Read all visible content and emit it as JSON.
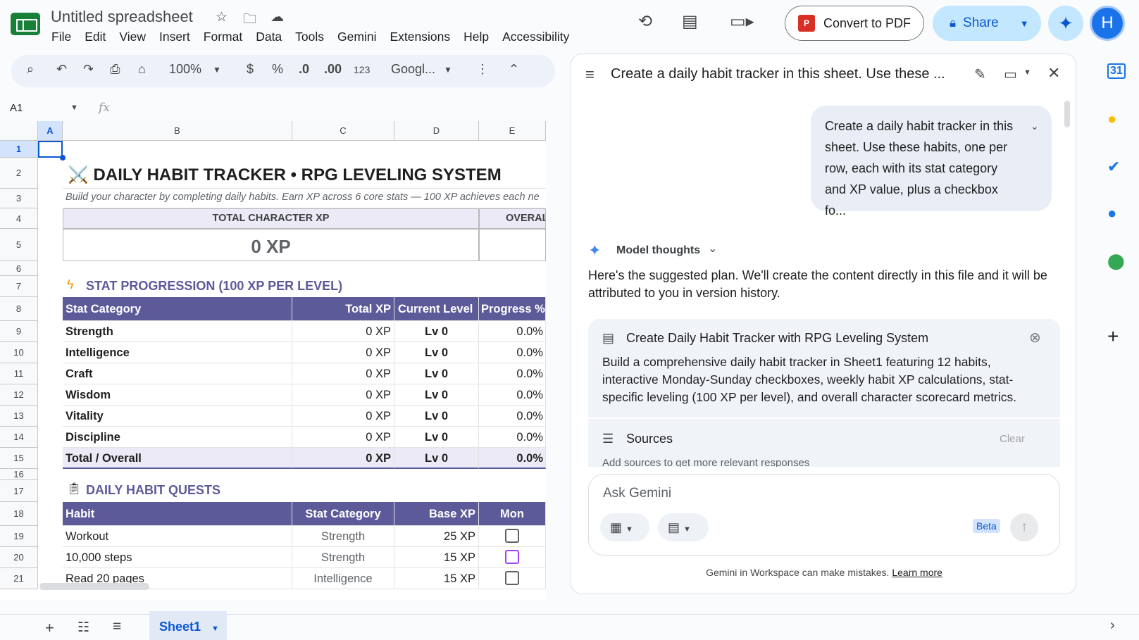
{
  "app": {
    "title": "Untitled spreadsheet",
    "avatar_letter": "H"
  },
  "menu": [
    "File",
    "Edit",
    "View",
    "Insert",
    "Format",
    "Data",
    "Tools",
    "Gemini",
    "Extensions",
    "Help",
    "Accessibility"
  ],
  "header": {
    "convert_label": "Convert to PDF",
    "share_label": "Share"
  },
  "toolbar": {
    "zoom": "100%",
    "currency": "$",
    "percent": "%",
    "dec_down": ".0",
    "dec_up": ".00",
    "format_123": "123",
    "font": "Googl..."
  },
  "formula": {
    "cell_ref": "A1",
    "fx": "fx"
  },
  "columns": [
    "A",
    "B",
    "C",
    "D",
    "E"
  ],
  "rows": [
    "1",
    "2",
    "3",
    "4",
    "5",
    "6",
    "7",
    "8",
    "9",
    "10",
    "11",
    "12",
    "13",
    "14",
    "15",
    "16",
    "17",
    "18",
    "19",
    "20",
    "21"
  ],
  "sheet": {
    "title": "⚔️ DAILY HABIT TRACKER • RPG LEVELING SYSTEM",
    "subtitle": "Build your character by completing daily habits. Earn XP across 6 core stats — 100 XP achieves each ne",
    "total_label": "TOTAL CHARACTER XP",
    "overall_label": "OVERAL",
    "total_value": "0 XP",
    "stat_section": "STAT PROGRESSION (100 XP PER LEVEL)",
    "stat_headers": [
      "Stat Category",
      "Total XP",
      "Current Level",
      "Progress %"
    ],
    "stats": [
      {
        "name": "Strength",
        "xp": "0 XP",
        "level": "Lv 0",
        "progress": "0.0%"
      },
      {
        "name": "Intelligence",
        "xp": "0 XP",
        "level": "Lv 0",
        "progress": "0.0%"
      },
      {
        "name": "Craft",
        "xp": "0 XP",
        "level": "Lv 0",
        "progress": "0.0%"
      },
      {
        "name": "Wisdom",
        "xp": "0 XP",
        "level": "Lv 0",
        "progress": "0.0%"
      },
      {
        "name": "Vitality",
        "xp": "0 XP",
        "level": "Lv 0",
        "progress": "0.0%"
      },
      {
        "name": "Discipline",
        "xp": "0 XP",
        "level": "Lv 0",
        "progress": "0.0%"
      }
    ],
    "stat_total": {
      "name": "Total / Overall",
      "xp": "0 XP",
      "level": "Lv 0",
      "progress": "0.0%"
    },
    "quest_section": "DAILY HABIT QUESTS",
    "quest_headers": [
      "Habit",
      "Stat Category",
      "Base XP",
      "Mon"
    ],
    "quests": [
      {
        "habit": "Workout",
        "stat": "Strength",
        "xp": "25 XP"
      },
      {
        "habit": "10,000 steps",
        "stat": "Strength",
        "xp": "15 XP"
      },
      {
        "habit": "Read 20 pages",
        "stat": "Intelligence",
        "xp": "15 XP"
      }
    ]
  },
  "tabs": {
    "sheet1": "Sheet1"
  },
  "gemini": {
    "title": "Create a daily habit tracker in this sheet. Use these ...",
    "prompt": "Create a daily habit tracker in this sheet. Use these habits, one per row, each with its stat category and XP value, plus a checkbox fo...",
    "thoughts_label": "Model thoughts",
    "intro": "Here's the suggested plan. We'll create the content directly in this file and it will be attributed to you in version history.",
    "plan_title": "Create Daily Habit Tracker with RPG Leveling System",
    "plan_body": "Build a comprehensive daily habit tracker in Sheet1 featuring 12 habits, interactive Monday-Sunday checkboxes, weekly habit XP calculations, stat-specific leveling (100 XP per level), and overall character scorecard metrics.",
    "sources_label": "Sources",
    "clear_label": "Clear",
    "sources_hint": "Add sources to get more relevant responses",
    "ask_placeholder": "Ask Gemini",
    "beta": "Beta",
    "footer": "Gemini in Workspace can make mistakes.",
    "learn_more": "Learn more"
  },
  "colors": {
    "accent": "#5d5a99",
    "highlight": "#eceaf6",
    "brand": "#0b57d0"
  }
}
